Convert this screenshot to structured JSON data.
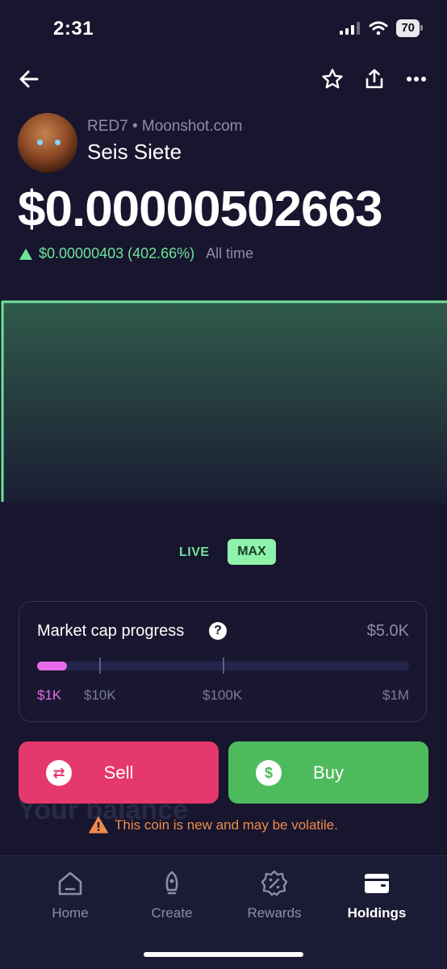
{
  "status_bar": {
    "time": "2:31",
    "battery": "70"
  },
  "header": {
    "back_icon": "arrow-left-icon",
    "favorite_icon": "star-icon",
    "share_icon": "share-icon",
    "more_icon": "ellipsis-icon"
  },
  "coin": {
    "ticker_source": "RED7 • Moonshot.com",
    "name": "Seis Siete",
    "price": "$0.00000502663",
    "change": "$0.00000403 (402.66%)",
    "range_label": "All time"
  },
  "chart": {
    "toggle_live": "LIVE",
    "toggle_max": "MAX",
    "line_color": "#6fe39a"
  },
  "market_cap": {
    "title": "Market cap progress",
    "value": "$5.0K",
    "progress_fraction": 0.08,
    "ticks": [
      "$1K",
      "$10K",
      "$100K",
      "$1M"
    ]
  },
  "actions": {
    "sell_label": "Sell",
    "buy_label": "Buy"
  },
  "background_text": "Your balance",
  "warning": "This coin is new and may be volatile.",
  "tabs": [
    {
      "label": "Home",
      "icon": "home-icon"
    },
    {
      "label": "Create",
      "icon": "rocket-icon"
    },
    {
      "label": "Rewards",
      "icon": "percent-badge-icon"
    },
    {
      "label": "Holdings",
      "icon": "wallet-icon"
    }
  ],
  "colors": {
    "background": "#17162e",
    "accent_green": "#6fe39a",
    "sell": "#e5386c",
    "buy": "#4dbb5c",
    "progress": "#e56be8",
    "warning": "#ef8b4c"
  }
}
